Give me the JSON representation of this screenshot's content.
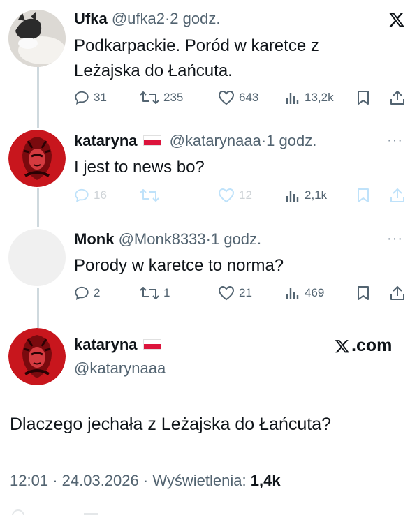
{
  "tweets": [
    {
      "name": "Ufka",
      "handle": "@ufka2",
      "dot": "·",
      "time": "2 godz.",
      "text_line1": "Podkarpackie. Poród w karetce z",
      "text_line2": "Leżajska do Łańcuta.",
      "replies": "31",
      "retweets": "235",
      "likes": "643",
      "views": "13,2k"
    },
    {
      "name": "kataryna",
      "handle": "@katarynaaa",
      "dot": "·",
      "time": "1 godz.",
      "text_line1": "I jest to news bo?",
      "replies": "16",
      "likes": "12",
      "views": "2,1k"
    },
    {
      "name": "Monk",
      "handle": "@Monk8333",
      "dot": "·",
      "time": "1 godz.",
      "text_line1": "Porody w karetce to norma?",
      "replies": "2",
      "retweets": "1",
      "likes": "21",
      "views": "469"
    }
  ],
  "main": {
    "name": "kataryna",
    "handle": "@katarynaaa",
    "xcom_label": ".com",
    "text": "Dlaczego jechała z Leżajska do Łańcuta?",
    "time": "12:01",
    "sep1": "·",
    "date": "24.03.2026",
    "sep2": "·",
    "views_label": "Wyświetlenia:",
    "views_value": "1,4k"
  },
  "more_label": "···",
  "icons": [
    "x-logo-icon",
    "reply-icon",
    "retweet-icon",
    "like-icon",
    "views-icon",
    "bookmark-icon",
    "share-icon",
    "poland-flag-icon"
  ],
  "colors": {
    "text": "#0f1419",
    "secondary": "#536471",
    "thread_line": "#cfd9de",
    "avatar_red": "#c8161d"
  }
}
